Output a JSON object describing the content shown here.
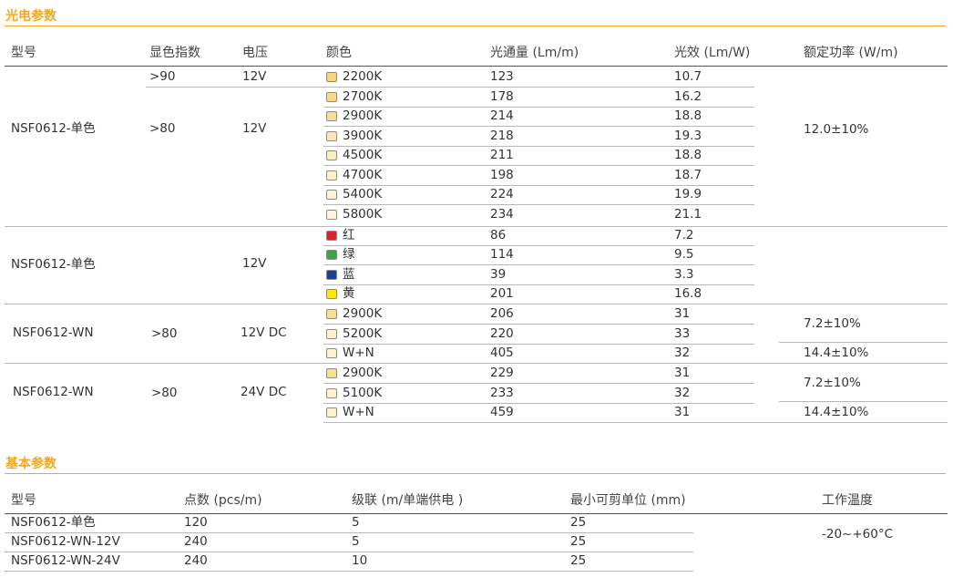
{
  "section1": {
    "title": "光电参数",
    "headers": [
      "型号",
      "显色指数",
      "电压",
      "颜色",
      "光通量 (Lm/m)",
      "光效 (Lm/W)",
      "额定功率 (W/m)"
    ],
    "group1": {
      "model": "NSF0612-单色",
      "cri_a": ">90",
      "cri_b": ">80",
      "voltage_a": "12V",
      "voltage_b": "12V",
      "power": "12.0±10%",
      "rows": [
        {
          "color": "2200K",
          "swatch": "#F6D679",
          "flux": "123",
          "eff": "10.7"
        },
        {
          "color": "2700K",
          "swatch": "#F7DB86",
          "flux": "178",
          "eff": "16.2"
        },
        {
          "color": "2900K",
          "swatch": "#F8DF92",
          "flux": "214",
          "eff": "18.8"
        },
        {
          "color": "3900K",
          "swatch": "#FAE9B0",
          "flux": "218",
          "eff": "19.3"
        },
        {
          "color": "4500K",
          "swatch": "#FBEDBC",
          "flux": "211",
          "eff": "18.8"
        },
        {
          "color": "4700K",
          "swatch": "#FCF0C6",
          "flux": "198",
          "eff": "18.7"
        },
        {
          "color": "5400K",
          "swatch": "#FDF3D2",
          "flux": "224",
          "eff": "19.9"
        },
        {
          "color": "5800K",
          "swatch": "#FEF6DC",
          "flux": "234",
          "eff": "21.1"
        }
      ]
    },
    "group2": {
      "model": "NSF0612-单色",
      "voltage": "12V",
      "rows": [
        {
          "color": "红",
          "swatch": "#D7262B",
          "flux": "86",
          "eff": "7.2"
        },
        {
          "color": "绿",
          "swatch": "#3AA543",
          "flux": "114",
          "eff": "9.5"
        },
        {
          "color": "蓝",
          "swatch": "#1F3E94",
          "flux": "39",
          "eff": "3.3"
        },
        {
          "color": "黄",
          "swatch": "#FFE600",
          "flux": "201",
          "eff": "16.8"
        }
      ]
    },
    "group3": {
      "model": "NSF0612-WN",
      "cri": ">80",
      "voltage": "12V DC",
      "power_a": "7.2±10%",
      "power_b": "14.4±10%",
      "rows": [
        {
          "color": "2900K",
          "swatch": "#F8DF92",
          "flux": "206",
          "eff": "31"
        },
        {
          "color": "5200K",
          "swatch": "#FDF2CE",
          "flux": "220",
          "eff": "33"
        },
        {
          "color": "W+N",
          "swatch": "#FDF0CA",
          "flux": "405",
          "eff": "32"
        }
      ]
    },
    "group4": {
      "model": "NSF0612-WN",
      "cri": ">80",
      "voltage": "24V DC",
      "power_a": "7.2±10%",
      "power_b": "14.4±10%",
      "rows": [
        {
          "color": "2900K",
          "swatch": "#F8DF92",
          "flux": "229",
          "eff": "31"
        },
        {
          "color": "5100K",
          "swatch": "#FDF1CC",
          "flux": "233",
          "eff": "32"
        },
        {
          "color": "W+N",
          "swatch": "#FDF0CA",
          "flux": "459",
          "eff": "31"
        }
      ]
    }
  },
  "section2": {
    "title": "基本参数",
    "headers": [
      "型号",
      "点数 (pcs/m)",
      "级联 (m/单端供电 )",
      "最小可剪单位 (mm)",
      "工作温度"
    ],
    "rows": [
      {
        "model": "NSF0612-单色",
        "points": "120",
        "cascade": "5",
        "cut": "25"
      },
      {
        "model": "NSF0612-WN-12V",
        "points": "240",
        "cascade": "5",
        "cut": "25"
      },
      {
        "model": "NSF0612-WN-24V",
        "points": "240",
        "cascade": "10",
        "cut": "25"
      }
    ],
    "temperature": "-20~+60°C"
  },
  "colors": {
    "accent": "#F2A81E",
    "text": "#333333",
    "rule": "#B8B8B8",
    "swatch_border": "#8a8a8a"
  }
}
